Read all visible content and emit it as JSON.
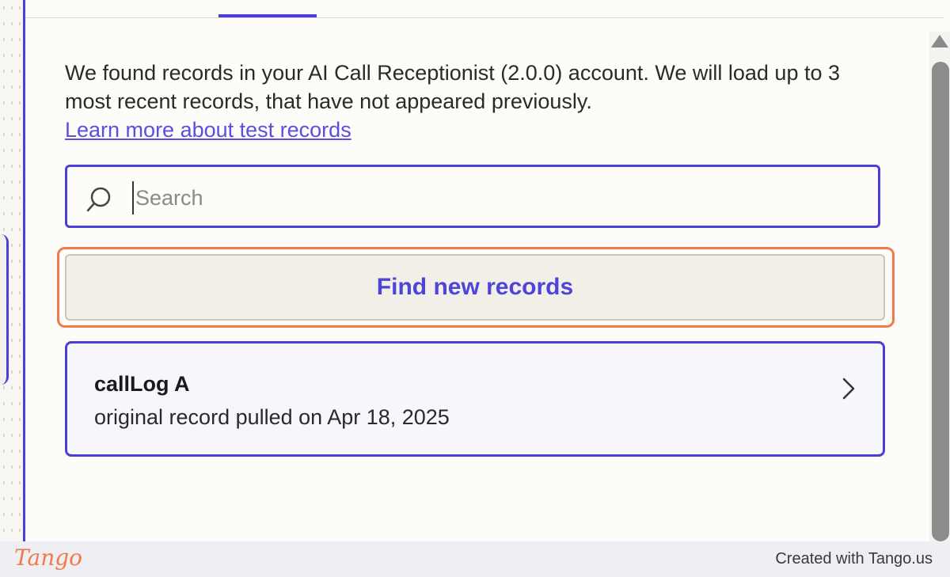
{
  "description": {
    "text": "We found records in your AI Call Receptionist (2.0.0) account. We will load up to 3 most recent records, that have not appeared previously.",
    "link_label": "Learn more about test records"
  },
  "search": {
    "placeholder": "Search",
    "value": ""
  },
  "find_button": {
    "label": "Find new records"
  },
  "records": [
    {
      "title": "callLog A",
      "subtitle": "original record pulled on Apr 18, 2025"
    }
  ],
  "footer": {
    "logo": "Tango",
    "credit": "Created with Tango.us"
  },
  "colors": {
    "accent": "#4a3fd6",
    "highlight": "#f07a48",
    "button_text": "#4f44d9"
  }
}
